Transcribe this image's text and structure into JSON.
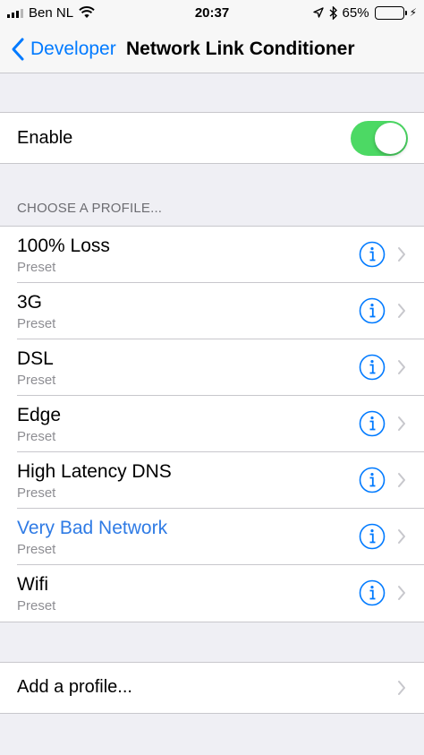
{
  "status_bar": {
    "carrier": "Ben NL",
    "time": "20:37",
    "battery_percent": "65%",
    "battery_level": 0.65,
    "icons": [
      "signal-icon",
      "wifi-icon",
      "location-icon",
      "bluetooth-icon",
      "battery-icon",
      "charging-icon"
    ]
  },
  "nav": {
    "back_label": "Developer",
    "title": "Network Link Conditioner"
  },
  "enable": {
    "label": "Enable",
    "on": true
  },
  "profiles_header": "CHOOSE A PROFILE...",
  "profiles": [
    {
      "name": "100% Loss",
      "subtitle": "Preset",
      "selected": false
    },
    {
      "name": "3G",
      "subtitle": "Preset",
      "selected": false
    },
    {
      "name": "DSL",
      "subtitle": "Preset",
      "selected": false
    },
    {
      "name": "Edge",
      "subtitle": "Preset",
      "selected": false
    },
    {
      "name": "High Latency DNS",
      "subtitle": "Preset",
      "selected": false
    },
    {
      "name": "Very Bad Network",
      "subtitle": "Preset",
      "selected": true
    },
    {
      "name": "Wifi",
      "subtitle": "Preset",
      "selected": false
    }
  ],
  "add_profile_label": "Add a profile...",
  "colors": {
    "accent": "#007aff",
    "selected_text": "#2f7be5",
    "toggle_on": "#4cd964",
    "background": "#efeff4"
  }
}
